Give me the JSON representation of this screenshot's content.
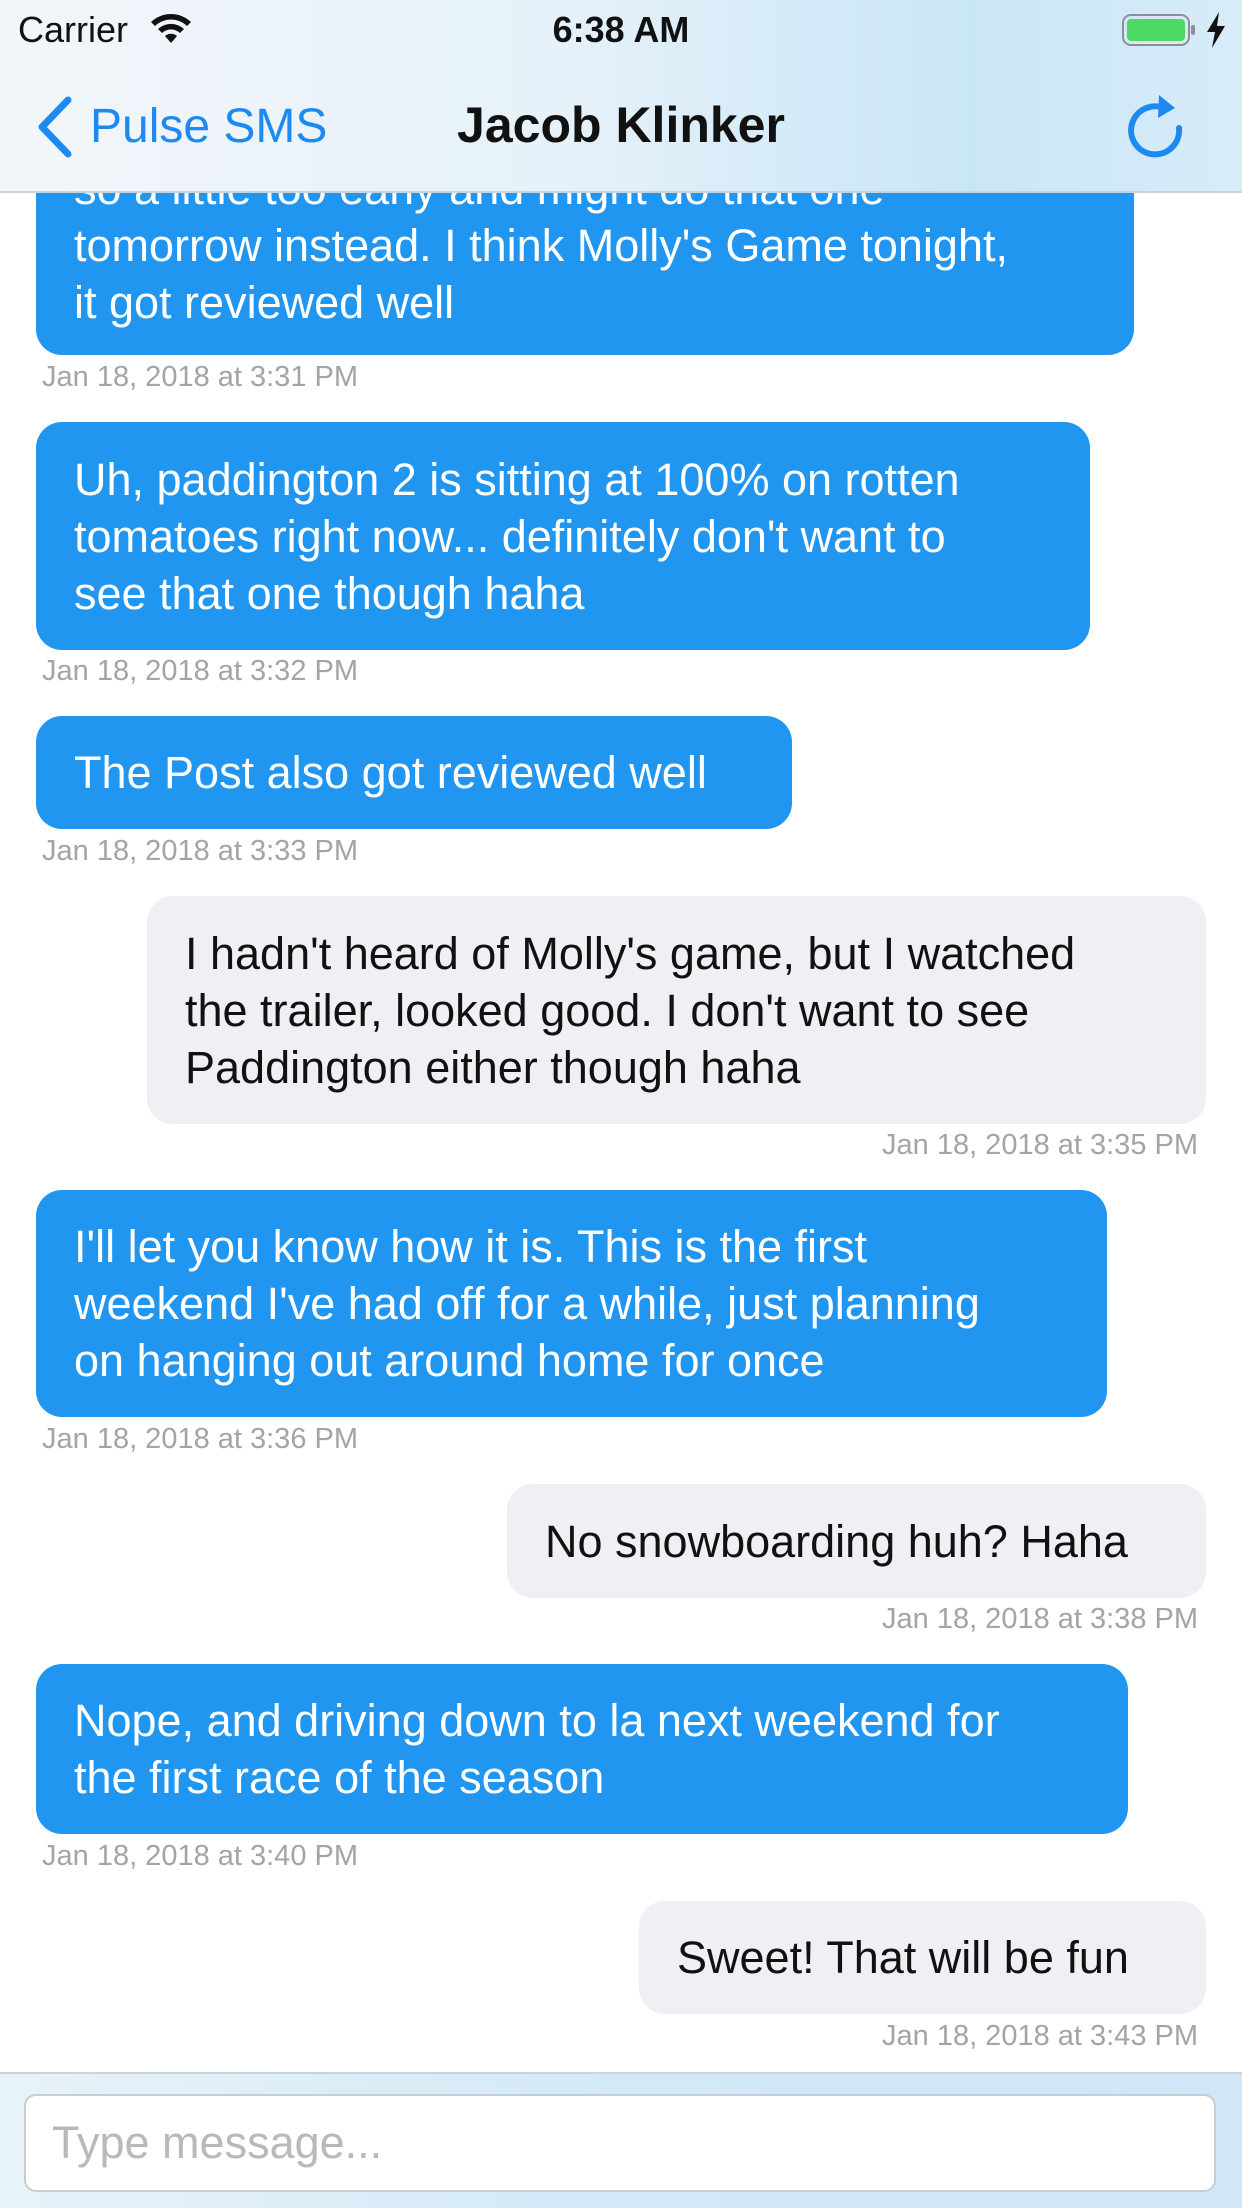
{
  "status_bar": {
    "carrier": "Carrier",
    "time": "6:38 AM",
    "wifi_icon": "wifi-icon",
    "battery_icon": "battery-icon",
    "battery_color": "#4cd964",
    "charging_icon": "charging-bolt-icon"
  },
  "nav": {
    "back_label": "Pulse SMS",
    "title": "Jacob Klinker",
    "back_icon": "chevron-left-icon",
    "refresh_icon": "refresh-icon",
    "accent": "#1d8af2"
  },
  "colors": {
    "incoming_bubble": "#2196f0",
    "outgoing_bubble": "#efeff4",
    "timestamp": "#a4a4a8"
  },
  "messages": [
    {
      "direction": "incoming",
      "lines": [
        "so a little too early and might do that one",
        "tomorrow instead. I think Molly's Game tonight,",
        "it got reviewed well"
      ],
      "timestamp": "Jan 18, 2018 at 3:31 PM"
    },
    {
      "direction": "incoming",
      "lines": [
        "Uh, paddington 2 is sitting at 100% on rotten",
        "tomatoes right now... definitely don't want to",
        "see that one though haha"
      ],
      "timestamp": "Jan 18, 2018 at 3:32 PM"
    },
    {
      "direction": "incoming",
      "lines": [
        "The Post also got reviewed well"
      ],
      "timestamp": "Jan 18, 2018 at 3:33 PM"
    },
    {
      "direction": "outgoing",
      "lines": [
        "I hadn't heard of Molly's game, but I watched",
        "the trailer, looked good. I don't want to see",
        "Paddington either though haha"
      ],
      "timestamp": "Jan 18, 2018 at 3:35 PM"
    },
    {
      "direction": "incoming",
      "lines": [
        "I'll let you know how it is. This is the first",
        "weekend I've had off for a while, just planning",
        "on hanging out around home for once"
      ],
      "timestamp": "Jan 18, 2018 at 3:36 PM"
    },
    {
      "direction": "outgoing",
      "lines": [
        "No snowboarding huh? Haha"
      ],
      "timestamp": "Jan 18, 2018 at 3:38 PM"
    },
    {
      "direction": "incoming",
      "lines": [
        "Nope, and driving down to la next weekend for",
        "the first race of the season"
      ],
      "timestamp": "Jan 18, 2018 at 3:40 PM"
    },
    {
      "direction": "outgoing",
      "lines": [
        "Sweet! That will be fun"
      ],
      "timestamp": "Jan 18, 2018 at 3:43 PM"
    }
  ],
  "composer": {
    "placeholder": "Type message...",
    "value": ""
  }
}
